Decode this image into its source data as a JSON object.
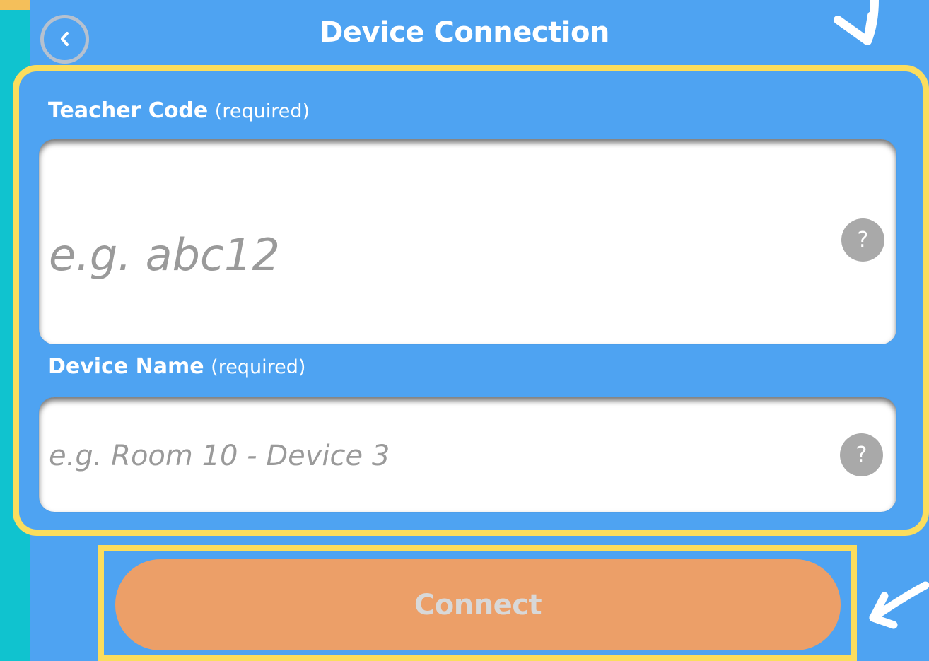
{
  "header": {
    "title": "Device Connection",
    "back_icon": "chevron-left-icon"
  },
  "form": {
    "teacher_code": {
      "label": "Teacher Code",
      "note": "(required)",
      "placeholder": "e.g. abc12",
      "value": "",
      "help_text": "?"
    },
    "device_name": {
      "label": "Device Name",
      "note": "(required)",
      "placeholder": "e.g. Room 10 - Device 3",
      "value": "",
      "help_text": "?"
    }
  },
  "actions": {
    "connect_label": "Connect"
  },
  "colors": {
    "background": "#10c3cf",
    "panel": "#4ea3f2",
    "highlight": "#fbdd5d",
    "button": "#ec9f68",
    "input": "#ffffff"
  }
}
